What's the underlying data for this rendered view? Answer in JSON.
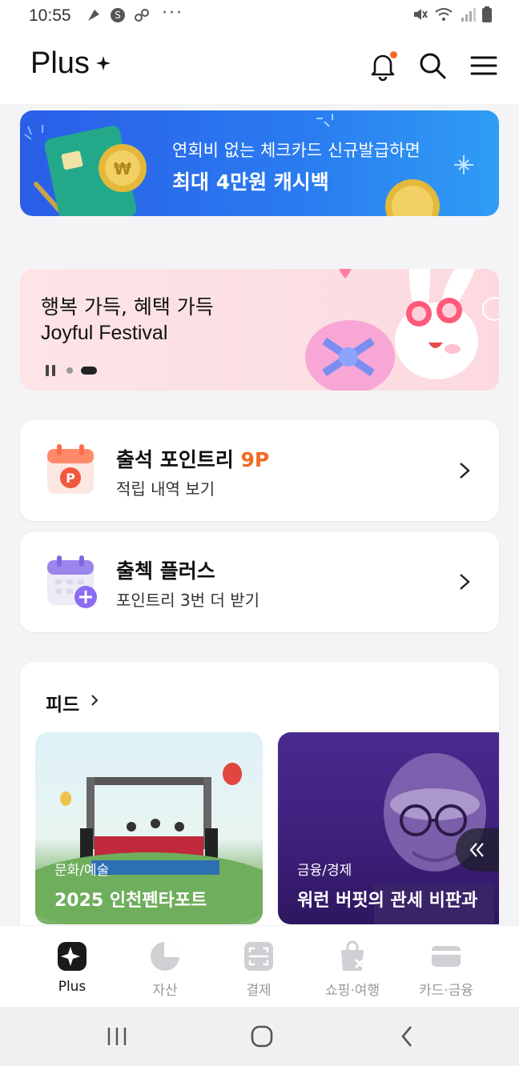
{
  "status": {
    "time": "10:55",
    "dots": "···"
  },
  "header": {
    "title": "Plus"
  },
  "banner_card": {
    "line1": "연회비 없는 체크카드 신규발급하면",
    "line2": "최대 4만원 캐시백"
  },
  "banner_festival": {
    "line1": "행복 가득, 혜택 가득",
    "line2": "Joyful Festival"
  },
  "attendance": {
    "title": "출석 포인트리",
    "points": "9P",
    "subtitle": "적립 내역 보기"
  },
  "checkin_plus": {
    "title": "출첵 플러스",
    "subtitle": "포인트리 3번 더 받기"
  },
  "feed": {
    "title": "피드",
    "cards": [
      {
        "category": "문화/예술",
        "title": "2025 인천펜타포트"
      },
      {
        "category": "금융/경제",
        "title": "워런 버핏의 관세 비판과"
      }
    ]
  },
  "bottom_nav": [
    {
      "label": "Plus",
      "active": true
    },
    {
      "label": "자산",
      "active": false
    },
    {
      "label": "결제",
      "active": false
    },
    {
      "label": "쇼핑·여행",
      "active": false
    },
    {
      "label": "카드·금융",
      "active": false
    }
  ],
  "colors": {
    "accent": "#f26b21",
    "banner_blue": "#2a7cf0",
    "banner_pink": "#fde4e6",
    "feed_purple": "#3d1f7a"
  }
}
